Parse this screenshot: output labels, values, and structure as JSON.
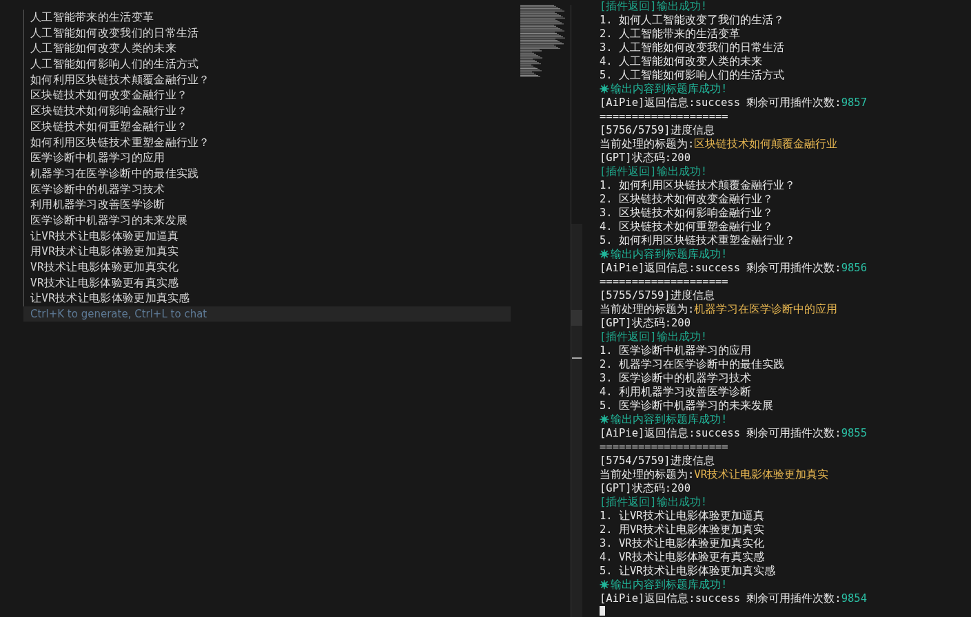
{
  "editor": {
    "lines": [
      {
        "text": "人工智能带来的生活变革"
      },
      {
        "text": "人工智能如何改变我们的日常生活"
      },
      {
        "text": "人工智能如何改变人类的未来"
      },
      {
        "text": "人工智能如何影响人们的生活方式"
      },
      {
        "text": "如何利用区块链技术颠覆金融行业？"
      },
      {
        "text": "区块链技术如何改变金融行业？"
      },
      {
        "text": "区块链技术如何影响金融行业？"
      },
      {
        "text": "区块链技术如何重塑金融行业？"
      },
      {
        "text": "如何利用区块链技术重塑金融行业？"
      },
      {
        "text": "医学诊断中机器学习的应用"
      },
      {
        "text": "机器学习在医学诊断中的最佳实践"
      },
      {
        "text": "医学诊断中的机器学习技术"
      },
      {
        "text": "利用机器学习改善医学诊断"
      },
      {
        "text": "医学诊断中机器学习的未来发展"
      },
      {
        "text": "让VR技术让电影体验更加逼真"
      },
      {
        "text": "用VR技术让电影体验更加真实"
      },
      {
        "text": "VR技术让电影体验更加真实化"
      },
      {
        "text": "VR技术让电影体验更有真实感"
      },
      {
        "text": "让VR技术让电影体验更加真实感"
      }
    ],
    "prompt": {
      "placeholder": "Ctrl+K to generate, Ctrl+L to chat"
    }
  },
  "terminal": {
    "lines": [
      {
        "kind": "plugin",
        "text": "[插件返回]输出成功!"
      },
      {
        "kind": "item",
        "text": "1. 如何人工智能改变了我们的生活？"
      },
      {
        "kind": "item",
        "text": "2. 人工智能带来的生活变革"
      },
      {
        "kind": "item",
        "text": "3. 人工智能如何改变我们的日常生活"
      },
      {
        "kind": "item",
        "text": "4. 人工智能如何改变人类的未来"
      },
      {
        "kind": "item",
        "text": "5. 人工智能如何影响人们的生活方式"
      },
      {
        "kind": "saved",
        "text": "输出内容到标题库成功!"
      },
      {
        "kind": "aipie",
        "text": "[AiPie]返回信息:success 剩余可用插件次数:",
        "value": "9857"
      },
      {
        "kind": "rule",
        "text": "===================="
      },
      {
        "kind": "item",
        "text": "[5756/5759]进度信息"
      },
      {
        "kind": "current",
        "text": "当前处理的标题为:",
        "value": "区块链技术如何颠覆金融行业"
      },
      {
        "kind": "item",
        "text": "[GPT]状态码:200"
      },
      {
        "kind": "plugin",
        "text": "[插件返回]输出成功!"
      },
      {
        "kind": "item",
        "text": "1. 如何利用区块链技术颠覆金融行业？"
      },
      {
        "kind": "item",
        "text": "2. 区块链技术如何改变金融行业？"
      },
      {
        "kind": "item",
        "text": "3. 区块链技术如何影响金融行业？"
      },
      {
        "kind": "item",
        "text": "4. 区块链技术如何重塑金融行业？"
      },
      {
        "kind": "item",
        "text": "5. 如何利用区块链技术重塑金融行业？"
      },
      {
        "kind": "saved",
        "text": "输出内容到标题库成功!"
      },
      {
        "kind": "aipie",
        "text": "[AiPie]返回信息:success 剩余可用插件次数:",
        "value": "9856"
      },
      {
        "kind": "rule",
        "text": "===================="
      },
      {
        "kind": "item",
        "text": "[5755/5759]进度信息"
      },
      {
        "kind": "current",
        "text": "当前处理的标题为:",
        "value": "机器学习在医学诊断中的应用"
      },
      {
        "kind": "item",
        "text": "[GPT]状态码:200"
      },
      {
        "kind": "plugin",
        "text": "[插件返回]输出成功!"
      },
      {
        "kind": "item",
        "text": "1. 医学诊断中机器学习的应用"
      },
      {
        "kind": "item",
        "text": "2. 机器学习在医学诊断中的最佳实践"
      },
      {
        "kind": "item",
        "text": "3. 医学诊断中的机器学习技术"
      },
      {
        "kind": "item",
        "text": "4. 利用机器学习改善医学诊断"
      },
      {
        "kind": "item",
        "text": "5. 医学诊断中机器学习的未来发展"
      },
      {
        "kind": "saved",
        "text": "输出内容到标题库成功!"
      },
      {
        "kind": "aipie",
        "text": "[AiPie]返回信息:success 剩余可用插件次数:",
        "value": "9855"
      },
      {
        "kind": "rule",
        "text": "===================="
      },
      {
        "kind": "item",
        "text": "[5754/5759]进度信息"
      },
      {
        "kind": "current",
        "text": "当前处理的标题为:",
        "value": "VR技术让电影体验更加真实"
      },
      {
        "kind": "item",
        "text": "[GPT]状态码:200"
      },
      {
        "kind": "plugin",
        "text": "[插件返回]输出成功!"
      },
      {
        "kind": "item",
        "text": "1. 让VR技术让电影体验更加逼真"
      },
      {
        "kind": "item",
        "text": "2. 用VR技术让电影体验更加真实"
      },
      {
        "kind": "item",
        "text": "3. VR技术让电影体验更加真实化"
      },
      {
        "kind": "item",
        "text": "4. VR技术让电影体验更有真实感"
      },
      {
        "kind": "item",
        "text": "5. 让VR技术让电影体验更加真实感"
      },
      {
        "kind": "saved",
        "text": "输出内容到标题库成功!"
      },
      {
        "kind": "aipie",
        "text": "[AiPie]返回信息:success 剩余可用插件次数:",
        "value": "9854"
      }
    ]
  }
}
